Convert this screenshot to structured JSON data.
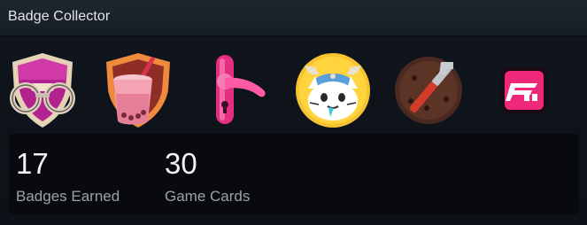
{
  "widget": {
    "title": "Badge Collector"
  },
  "badges": [
    {
      "name": "handcuffs-shield-badge"
    },
    {
      "name": "bubble-tea-shield-badge"
    },
    {
      "name": "door-handle-badge"
    },
    {
      "name": "viking-cat-badge"
    },
    {
      "name": "cookie-wrench-badge"
    },
    {
      "name": "forza-horizon-badge"
    }
  ],
  "stats": {
    "badges_earned": {
      "value": "17",
      "label": "Badges Earned"
    },
    "game_cards": {
      "value": "30",
      "label": "Game Cards"
    }
  }
}
